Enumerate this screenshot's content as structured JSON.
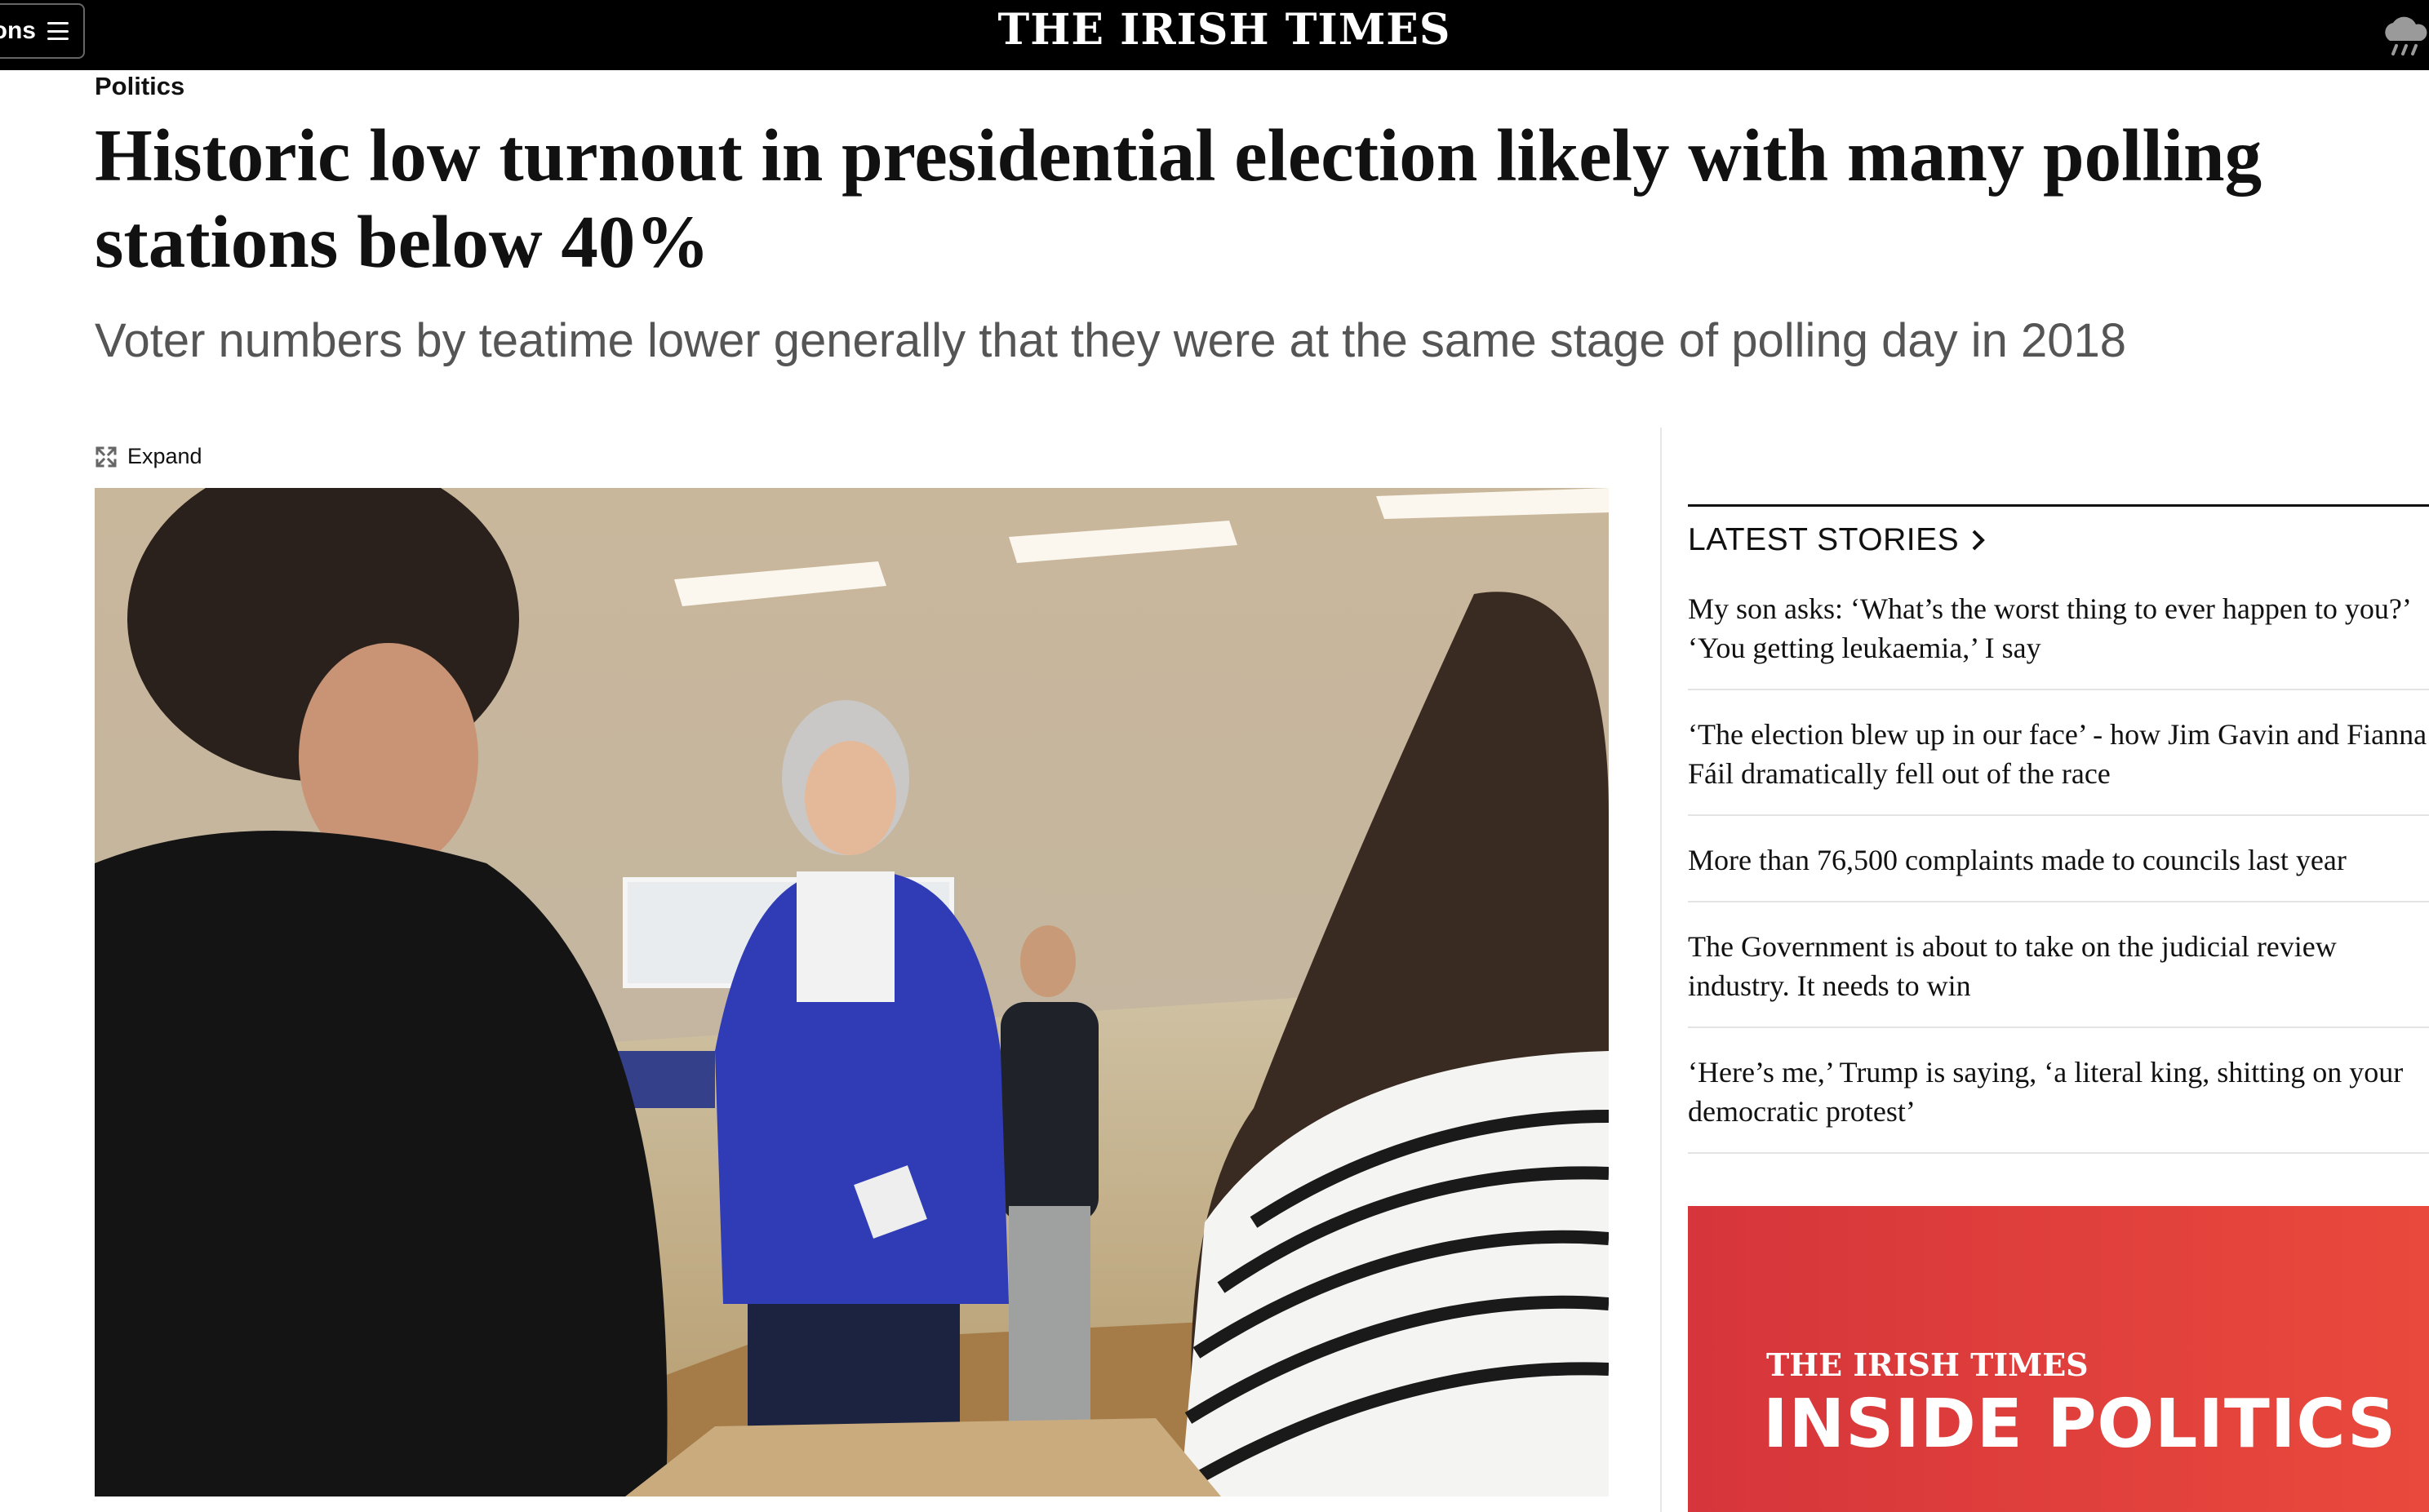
{
  "topbar": {
    "sections_label": "ons",
    "masthead": "THE IRISH TIMES",
    "weather_icon": "cloud-rain-icon",
    "menu_icon": "hamburger-icon",
    "background": "#000000"
  },
  "article": {
    "section": "Politics",
    "headline": "Historic low turnout in presidential election likely with many polling stations below 40%",
    "standfirst": "Voter numbers by teatime lower generally that they were at the same stage of polling day in 2018",
    "expand_label": "Expand",
    "expand_icon": "expand-arrows-icon"
  },
  "sidebar": {
    "latest_label": "LATEST STORIES",
    "latest_icon": "chevron-right-icon",
    "stories": [
      {
        "title": "My son asks: ‘What’s the worst thing to ever happen to you?’ ‘You getting leukaemia,’ I say"
      },
      {
        "title": "‘The election blew up in our face’ - how Jim Gavin and Fianna Fáil dramatically fell out of the race"
      },
      {
        "title": "More than 76,500 complaints made to councils last year"
      },
      {
        "title": "The Government is about to take on the judicial review industry. It needs to win"
      },
      {
        "title": "‘Here’s me,’ Trump is saying, ‘a literal king, shitting on your democratic protest’"
      }
    ],
    "promo": {
      "brand": "THE IRISH TIMES",
      "title": "INSIDE POLITICS",
      "color": "#e03a3c"
    }
  }
}
